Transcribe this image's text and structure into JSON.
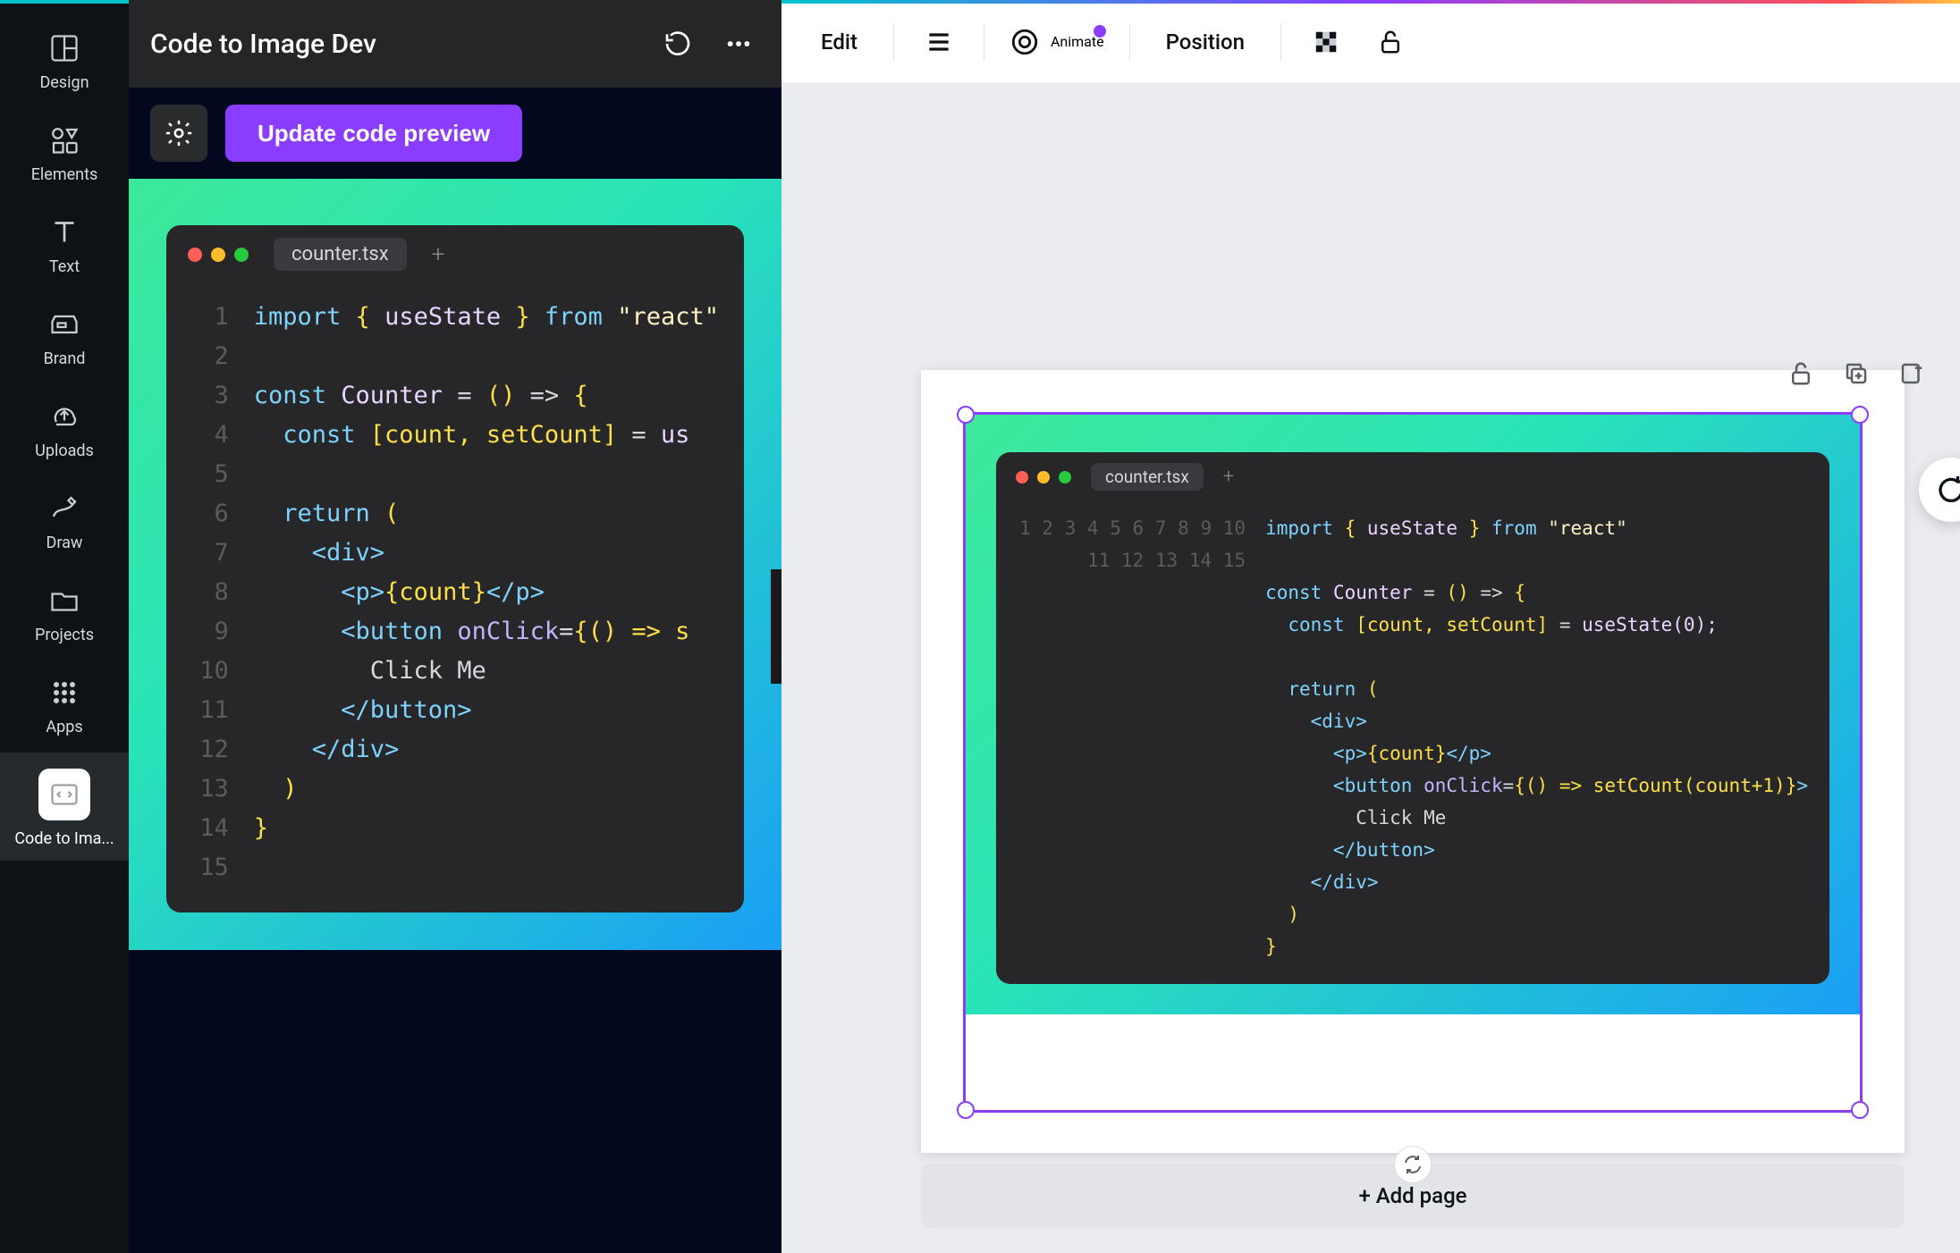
{
  "rail": {
    "items": [
      {
        "id": "design",
        "label": "Design"
      },
      {
        "id": "elements",
        "label": "Elements"
      },
      {
        "id": "text",
        "label": "Text"
      },
      {
        "id": "brand",
        "label": "Brand"
      },
      {
        "id": "uploads",
        "label": "Uploads"
      },
      {
        "id": "draw",
        "label": "Draw"
      },
      {
        "id": "projects",
        "label": "Projects"
      },
      {
        "id": "apps",
        "label": "Apps"
      },
      {
        "id": "code-to-image",
        "label": "Code to Ima..."
      }
    ],
    "active_index": 8
  },
  "panel": {
    "title": "Code to Image Dev",
    "update_button": "Update code preview"
  },
  "code": {
    "filename": "counter.tsx",
    "line_numbers": [
      "1",
      "2",
      "3",
      "4",
      "5",
      "6",
      "7",
      "8",
      "9",
      "10",
      "11",
      "12",
      "13",
      "14",
      "15"
    ],
    "tokens": {
      "import": "import",
      "lbrace": "{",
      "rbrace": "}",
      "useState": "useState",
      "from": "from",
      "react": "\"react\"",
      "const": "const",
      "Counter": "Counter",
      "eq": "=",
      "arrow_open": "()",
      "arrow": "=>",
      "count_decl_open": "[count, setCount]",
      "useState_call_short": "us",
      "useState_call_full": "useState(0);",
      "return": "return",
      "lparen": "(",
      "rparen": ")",
      "div_open": "<div>",
      "div_close": "</div>",
      "p_open": "<p>",
      "p_close": "</p>",
      "count_expr": "{count}",
      "button_open": "<button",
      "button_close_tag": "</button>",
      "onClick": "onClick",
      "onclick_body_short": "{() => s",
      "onclick_body_full": "{() => setCount(count+1)}",
      "gt": ">",
      "click_me": "Click Me",
      "brace_close": "}"
    }
  },
  "toolbar": {
    "edit": "Edit",
    "animate": "Animate",
    "position": "Position"
  },
  "canvas": {
    "add_page": "+ Add page"
  }
}
